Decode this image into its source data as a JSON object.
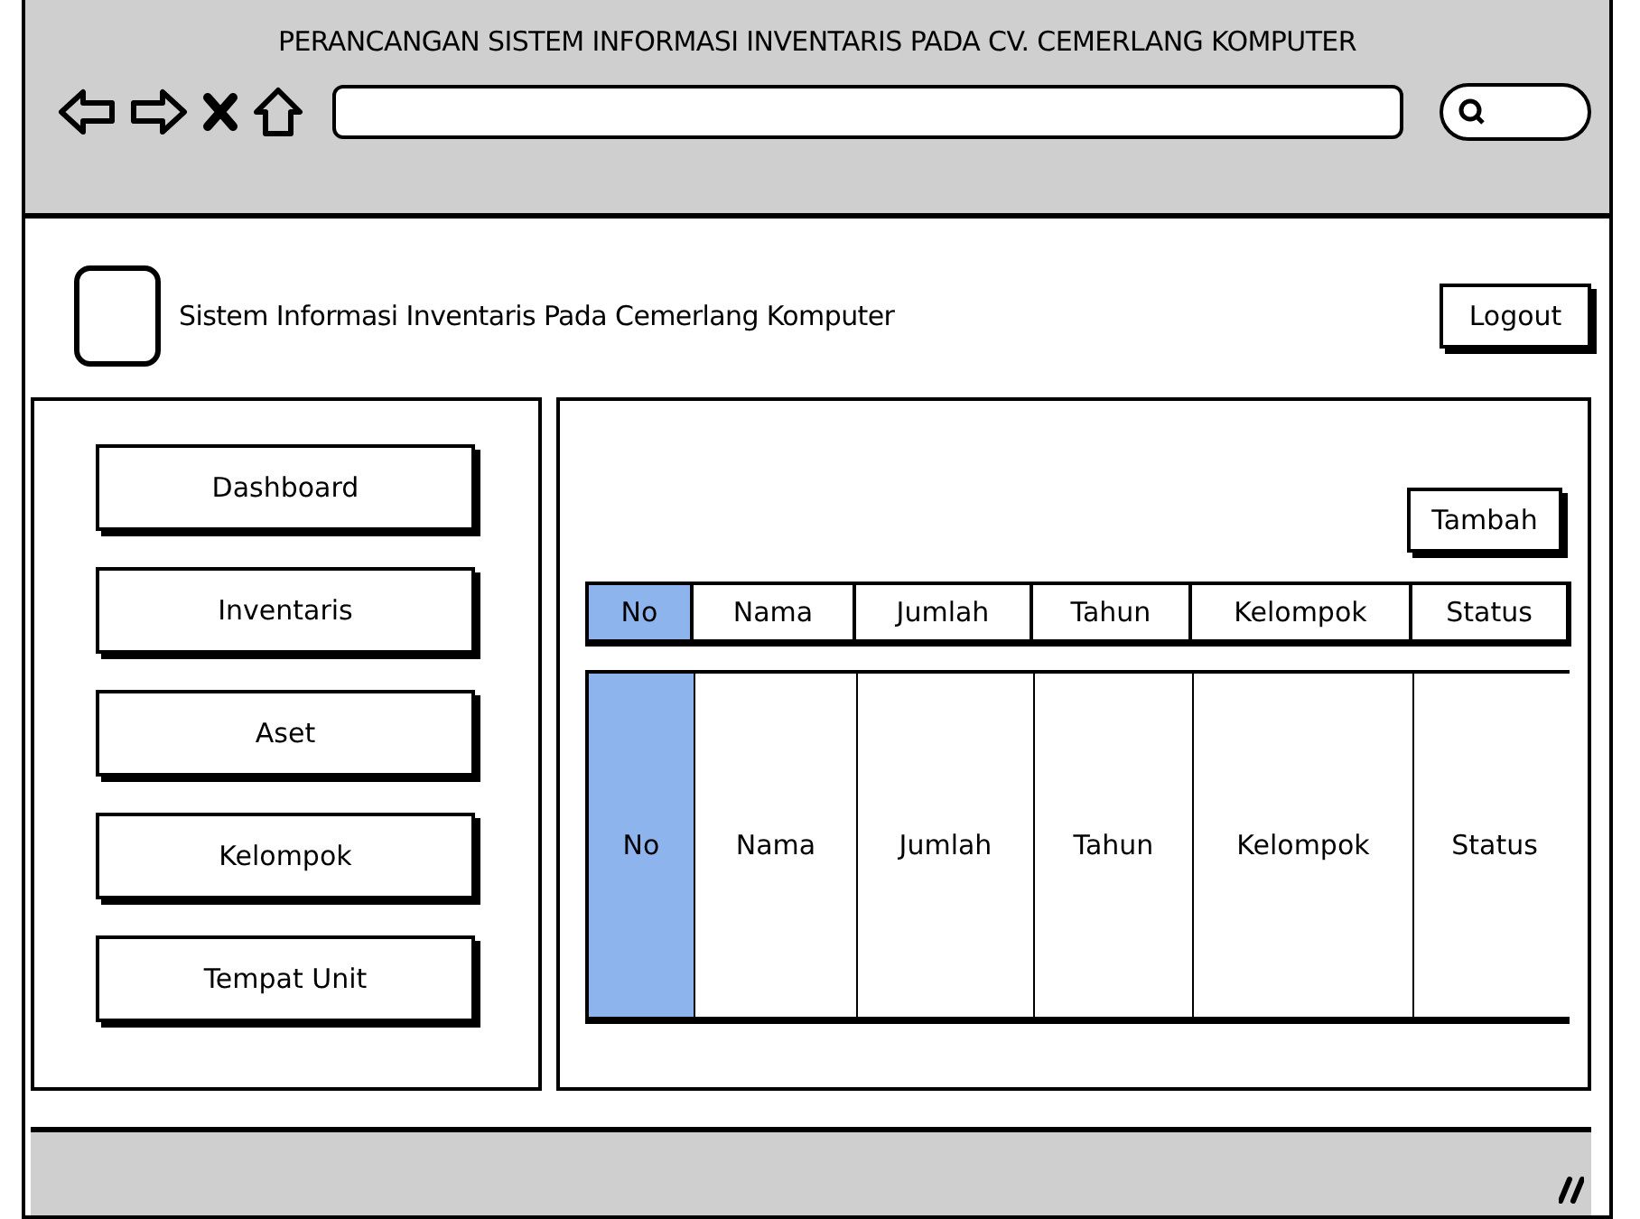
{
  "window": {
    "title": "PERANCANGAN SISTEM INFORMASI INVENTARIS PADA CV. CEMERLANG KOMPUTER"
  },
  "header": {
    "title": "Sistem Informasi Inventaris Pada Cemerlang Komputer",
    "logout": "Logout"
  },
  "sidebar": {
    "items": [
      {
        "label": "Dashboard"
      },
      {
        "label": "Inventaris"
      },
      {
        "label": "Aset"
      },
      {
        "label": "Kelompok"
      },
      {
        "label": "Tempat Unit"
      }
    ]
  },
  "main": {
    "add_button": "Tambah",
    "table": {
      "columns": [
        {
          "label": "No",
          "selected": true
        },
        {
          "label": "Nama",
          "selected": false
        },
        {
          "label": "Jumlah",
          "selected": false
        },
        {
          "label": "Tahun",
          "selected": false
        },
        {
          "label": "Kelompok",
          "selected": false
        },
        {
          "label": "Status",
          "selected": false
        }
      ],
      "rows": [
        {
          "cells": [
            "No",
            "Nama",
            "Jumlah",
            "Tahun",
            "Kelompok",
            "Status"
          ]
        }
      ]
    }
  }
}
